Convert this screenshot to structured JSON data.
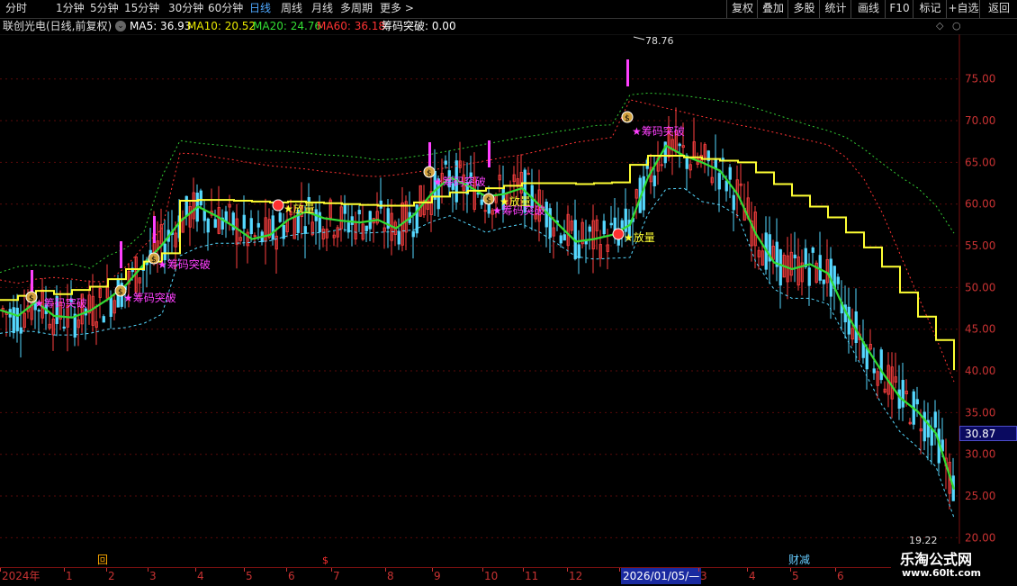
{
  "toolbar": {
    "timeframes": [
      "分时",
      "1分钟",
      "5分钟",
      "15分钟",
      "30分钟",
      "60分钟",
      "日线",
      "周线",
      "月线",
      "多周期",
      "更多 >"
    ],
    "active": "日线",
    "buttons": [
      "复权",
      "叠加",
      "多股",
      "统计",
      "画线",
      "F10",
      "标记",
      "+自选",
      "返回"
    ]
  },
  "info": {
    "title": "联创光电(日线,前复权)",
    "ma5": "MA5: 36.93",
    "ma10": "MA10: 20.52",
    "ma20": "MA20: 24.76",
    "ma60": "MA60: 36.18",
    "chip": "筹码突破: 0.00"
  },
  "colors": {
    "ma5": "#ffffff",
    "ma10": "#e8e800",
    "ma20": "#33dd33",
    "ma60": "#ff3333",
    "candle_up": "#ff4040",
    "candle_down": "#55d8ff",
    "label": "#ff40ff",
    "yellow": "#ffff33"
  },
  "current_price": "30.87",
  "price_axis": {
    "min": 19.5,
    "max": 79.5,
    "ticks": [
      "75.00",
      "70.00",
      "65.00",
      "60.00",
      "55.00",
      "50.00",
      "45.00",
      "40.00",
      "35.00",
      "30.00",
      "25.00",
      "20.00"
    ]
  },
  "time_axis": [
    "2024年",
    "1",
    "2",
    "3",
    "4",
    "5",
    "6",
    "7",
    "8",
    "9",
    "10",
    "11",
    "12",
    "2026/01/05/—",
    "3",
    "4",
    "5",
    "6"
  ],
  "markers": {
    "small_square": "回",
    "dollar": "$",
    "fangliang": "★放量",
    "chouma": "★筹码突破",
    "caiyuan": "财减"
  },
  "high_price_label": "78.76",
  "low_price_label": "19.22",
  "watermark": {
    "line1": "乐淘公式网",
    "line2": "www.60lt.com"
  },
  "chart_data": {
    "type": "line",
    "x": [
      0,
      20,
      40,
      60,
      80,
      100,
      120,
      140,
      160,
      180,
      200,
      220,
      240,
      260,
      280,
      300,
      320,
      340,
      360,
      380,
      400,
      420,
      440,
      460,
      480,
      500,
      520,
      540,
      560,
      580,
      600,
      620,
      640,
      660,
      680,
      700,
      720,
      740,
      760,
      780,
      800,
      820,
      840,
      860,
      880,
      900,
      920,
      940,
      960,
      980,
      1000,
      1020,
      1040,
      1060
    ],
    "series": [
      {
        "name": "MA20",
        "values": [
          47.3,
          46.6,
          48.3,
          46.6,
          46.4,
          47.2,
          48.6,
          50.3,
          52.8,
          55.1,
          57.9,
          59.7,
          58.6,
          57.3,
          55.8,
          56.3,
          58.1,
          59.1,
          58.3,
          58.0,
          57.8,
          58.1,
          57.1,
          58.7,
          61.3,
          63.2,
          62.2,
          60.9,
          61.2,
          61.9,
          59.8,
          57.6,
          55.5,
          55.8,
          56.3,
          57.5,
          63.2,
          67.0,
          65.8,
          65.0,
          64.0,
          61.1,
          56.4,
          53.0,
          52.2,
          52.8,
          51.7,
          47.0,
          43.3,
          39.9,
          36.8,
          35.1,
          32.5,
          25.8
        ]
      },
      {
        "name": "MA60",
        "values": [
          50.9,
          50.5,
          51.0,
          51.2,
          51.0,
          50.7,
          50.7,
          52.5,
          55.0,
          57.0,
          66.1,
          66.0,
          65.6,
          65.3,
          64.9,
          64.6,
          64.4,
          64.2,
          63.9,
          63.7,
          63.4,
          63.3,
          63.5,
          63.8,
          64.1,
          64.4,
          64.8,
          65.2,
          65.6,
          65.9,
          66.4,
          66.9,
          67.4,
          67.7,
          68.0,
          72.5,
          72.0,
          71.5,
          71.0,
          70.5,
          70.0,
          69.5,
          69.1,
          68.6,
          68.1,
          67.6,
          67.1,
          65.6,
          63.0,
          59.0,
          54.0,
          49.0,
          44.0,
          38.7
        ]
      },
      {
        "name": "band_upper",
        "values": [
          51.8,
          52.5,
          52.7,
          52.5,
          52.8,
          52.3,
          53.8,
          54.7,
          56.7,
          63.3,
          67.6,
          67.3,
          67.1,
          66.9,
          66.6,
          66.4,
          66.3,
          66.1,
          65.9,
          65.8,
          65.6,
          65.3,
          65.4,
          65.7,
          66.0,
          66.4,
          66.8,
          67.2,
          67.6,
          68.0,
          68.3,
          68.7,
          69.0,
          69.4,
          69.5,
          73.1,
          73.3,
          73.2,
          73.0,
          72.7,
          72.4,
          72.1,
          71.5,
          70.8,
          70.1,
          69.4,
          68.8,
          68.0,
          66.6,
          64.9,
          63.3,
          61.9,
          59.8,
          56.5
        ]
      },
      {
        "name": "band_lower",
        "values": [
          44.5,
          44.8,
          44.7,
          44.3,
          44.3,
          44.5,
          45.0,
          45.2,
          45.7,
          46.8,
          53.8,
          54.8,
          55.3,
          55.3,
          55.4,
          55.6,
          56.2,
          56.5,
          56.6,
          57.0,
          56.5,
          56.6,
          56.7,
          56.9,
          57.9,
          58.6,
          57.6,
          56.6,
          57.2,
          57.6,
          56.6,
          55.2,
          53.7,
          53.4,
          53.5,
          53.6,
          58.8,
          61.8,
          61.9,
          60.3,
          59.9,
          58.6,
          53.0,
          49.8,
          48.7,
          48.7,
          48.0,
          44.0,
          40.0,
          35.9,
          32.7,
          30.8,
          28.5,
          22.4
        ]
      },
      {
        "name": "band_mid",
        "values": [
          48.5,
          49.0,
          49.6,
          49.2,
          49.7,
          50.1,
          51.0,
          52.2,
          53.1,
          54.1,
          60.4,
          60.5,
          60.5,
          60.4,
          60.3,
          60.2,
          60.3,
          60.2,
          60.1,
          60.0,
          59.9,
          59.8,
          59.8,
          60.2,
          60.9,
          61.4,
          61.6,
          61.9,
          62.2,
          62.5,
          62.5,
          62.5,
          62.4,
          62.5,
          62.6,
          64.7,
          65.8,
          65.8,
          65.6,
          65.4,
          65.2,
          65.0,
          63.8,
          62.4,
          61.0,
          59.7,
          58.4,
          56.6,
          54.8,
          52.5,
          49.4,
          46.5,
          43.7,
          40.1
        ]
      }
    ],
    "ylim": [
      19.5,
      79.5
    ]
  }
}
